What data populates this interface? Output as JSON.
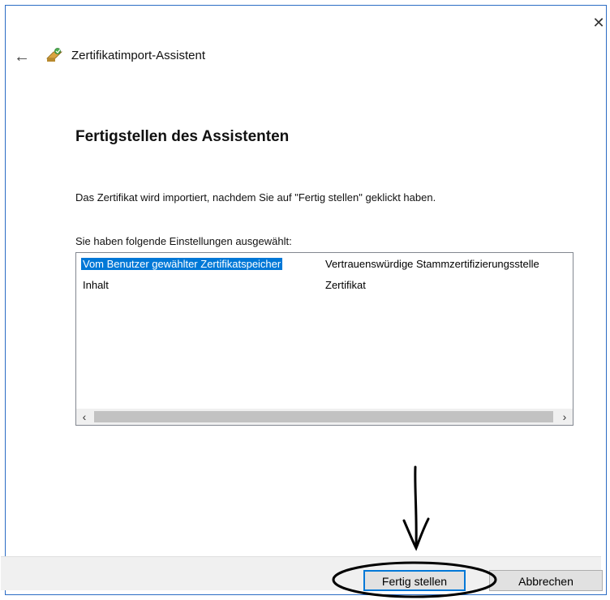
{
  "window": {
    "close_glyph": "✕",
    "back_glyph": "←",
    "title": "Zertifikatimport-Assistent"
  },
  "content": {
    "heading": "Fertigstellen des Assistenten",
    "intro": "Das Zertifikat wird importiert, nachdem Sie auf \"Fertig stellen\" geklickt haben.",
    "settings_label": "Sie haben folgende Einstellungen ausgewählt:",
    "settings": [
      {
        "key": "Vom Benutzer gewählter Zertifikatspeicher",
        "value": "Vertrauenswürdige Stammzertifizierungsstelle",
        "selected": true
      },
      {
        "key": "Inhalt",
        "value": "Zertifikat",
        "selected": false
      }
    ],
    "scroll_left_glyph": "‹",
    "scroll_right_glyph": "›"
  },
  "footer": {
    "finish_label": "Fertig stellen",
    "cancel_label": "Abbrechen"
  },
  "colors": {
    "accent": "#0078d7",
    "window_border": "#2b6cc4",
    "footer_bg": "#f0f0f0"
  },
  "icons": [
    "close-icon",
    "back-arrow-icon",
    "certificate-wizard-icon"
  ]
}
